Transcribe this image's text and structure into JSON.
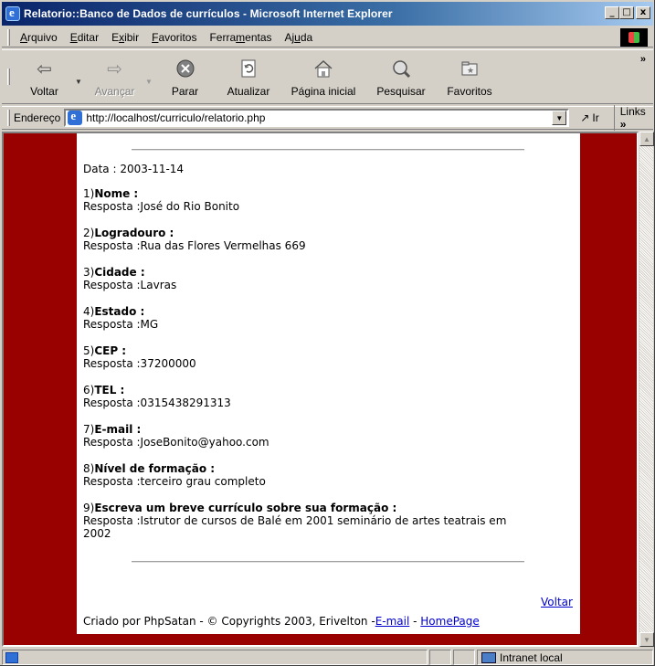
{
  "window": {
    "title": "Relatorio::Banco de Dados de currículos - Microsoft Internet Explorer",
    "icon": "ie-icon",
    "controls": [
      "_",
      "□",
      "x"
    ]
  },
  "menu": [
    {
      "pre": "",
      "key": "A",
      "post": "rquivo"
    },
    {
      "pre": "",
      "key": "E",
      "post": "ditar"
    },
    {
      "pre": "E",
      "key": "x",
      "post": "ibir"
    },
    {
      "pre": "",
      "key": "F",
      "post": "avoritos"
    },
    {
      "pre": "Ferra",
      "key": "m",
      "post": "entas"
    },
    {
      "pre": "Aj",
      "key": "u",
      "post": "da"
    }
  ],
  "toolbar": {
    "back": "Voltar",
    "forward": "Avançar",
    "stop": "Parar",
    "refresh": "Atualizar",
    "home": "Página inicial",
    "search": "Pesquisar",
    "favorites": "Favoritos"
  },
  "address": {
    "label": "Endereço",
    "url": "http://localhost/curriculo/relatorio.php",
    "go": "Ir",
    "links": "Links"
  },
  "report": {
    "date_line": "Data : 2003-11-14",
    "items": [
      {
        "num": "1)",
        "question": "Nome :",
        "answer": "Resposta :José do Rio Bonito"
      },
      {
        "num": "2)",
        "question": "Logradouro :",
        "answer": "Resposta :Rua das Flores Vermelhas 669"
      },
      {
        "num": "3)",
        "question": "Cidade :",
        "answer": "Resposta :Lavras"
      },
      {
        "num": "4)",
        "question": "Estado :",
        "answer": "Resposta :MG"
      },
      {
        "num": "5)",
        "question": "CEP :",
        "answer": "Resposta :37200000"
      },
      {
        "num": "6)",
        "question": "TEL :",
        "answer": "Resposta :0315438291313"
      },
      {
        "num": "7)",
        "question": "E-mail :",
        "answer": "Resposta :JoseBonito@yahoo.com"
      },
      {
        "num": "8)",
        "question": "Nível de formação :",
        "answer": "Resposta :terceiro grau completo"
      },
      {
        "num": "9)",
        "question": "Escreva um breve currículo sobre sua formação :",
        "answer": "Resposta :Istrutor de cursos de Balé em 2001 seminário de artes teatrais em",
        "answer_cont": "2002"
      }
    ],
    "back_link": "Voltar",
    "footer_prefix": "Criado por PhpSatan - © Copyrights 2003, Erivelton -",
    "footer_email": "E-mail",
    "footer_sep": " - ",
    "footer_home": "HomePage"
  },
  "status": {
    "zone": "Intranet local"
  },
  "colors": {
    "page_background": "#990000",
    "link": "#0000cc",
    "titlebar_start": "#0a246a"
  }
}
